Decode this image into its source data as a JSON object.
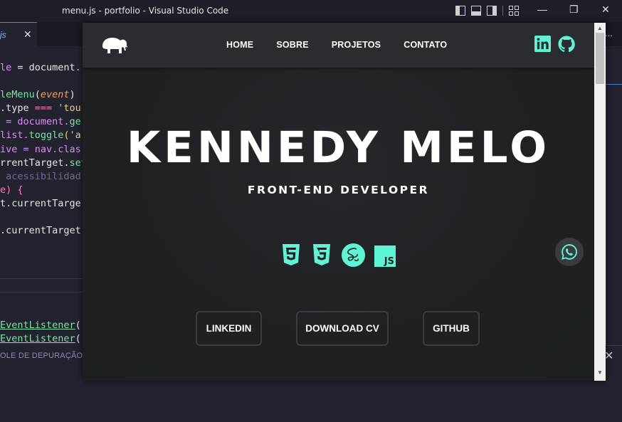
{
  "window": {
    "title": "menu.js - portfolio - Visual Studio Code",
    "minimize": "—",
    "restore": "❐",
    "close": "✕"
  },
  "tabs": [
    {
      "label": "js",
      "close": "✕"
    }
  ],
  "tabbar_more": "...",
  "code_lines": [
    [
      {
        "t": "le",
        "c": "c-var"
      },
      {
        "t": " = document.",
        "c": "c-w"
      }
    ],
    [],
    [
      {
        "t": "leMenu",
        "c": "c-fn"
      },
      {
        "t": "(",
        "c": "c-w"
      },
      {
        "t": "event",
        "c": "c-arg"
      },
      {
        "t": ")",
        "c": "c-w"
      }
    ],
    [
      {
        "t": ".type ",
        "c": "c-w"
      },
      {
        "t": "===",
        "c": "c-op"
      },
      {
        "t": " 'tou",
        "c": "c-str"
      }
    ],
    [
      {
        "t": " = document.",
        "c": "c-var"
      },
      {
        "t": "ge",
        "c": "c-fn"
      }
    ],
    [
      {
        "t": "list.",
        "c": "c-var"
      },
      {
        "t": "toggle",
        "c": "c-fn"
      },
      {
        "t": "('a",
        "c": "c-str"
      }
    ],
    [
      {
        "t": "ive = nav.",
        "c": "c-var"
      },
      {
        "t": "clas",
        "c": "c-var"
      }
    ],
    [
      {
        "t": "rrentTarget.",
        "c": "c-w"
      },
      {
        "t": "set",
        "c": "c-fn"
      }
    ],
    [
      {
        "t": " acessibilidad",
        "c": "c-cm"
      }
    ],
    [
      {
        "t": "e) {",
        "c": "c-kw"
      }
    ],
    [
      {
        "t": "t.currentTarge",
        "c": "c-w"
      }
    ],
    [],
    [
      {
        "t": ".currentTarget",
        "c": "c-w"
      }
    ]
  ],
  "code_lines2": [
    [
      {
        "t": "EventListener",
        "c": "c-fn u"
      },
      {
        "t": "(",
        "c": "c-w"
      }
    ],
    [
      {
        "t": "EventListener",
        "c": "c-fn u"
      },
      {
        "t": "(",
        "c": "c-w"
      }
    ]
  ],
  "console_label": "OLE DE DEPURAÇÃO",
  "bottom_close": "✕",
  "site": {
    "nav": [
      {
        "name": "nav-home",
        "label": "HOME"
      },
      {
        "name": "nav-sobre",
        "label": "SOBRE"
      },
      {
        "name": "nav-projetos",
        "label": "PROJETOS"
      },
      {
        "name": "nav-contato",
        "label": "CONTATO"
      }
    ],
    "hero_name": "KENNEDY MELO",
    "hero_role": "FRONT-END DEVELOPER",
    "tech_icons": [
      "html5-icon",
      "css3-icon",
      "sass-icon",
      "js-icon"
    ],
    "js_label": "JS",
    "buttons": [
      {
        "name": "linkedin-button",
        "label": "LINKEDIN"
      },
      {
        "name": "download-cv-button",
        "label": "DOWNLOAD CV"
      },
      {
        "name": "github-button",
        "label": "GITHUB"
      }
    ],
    "colors": {
      "accent": "#5ff5d4",
      "nav_bg": "#2b2c30",
      "page_bg": "#1f2022"
    }
  },
  "scroll": {
    "up": "▲",
    "down": "▼"
  }
}
